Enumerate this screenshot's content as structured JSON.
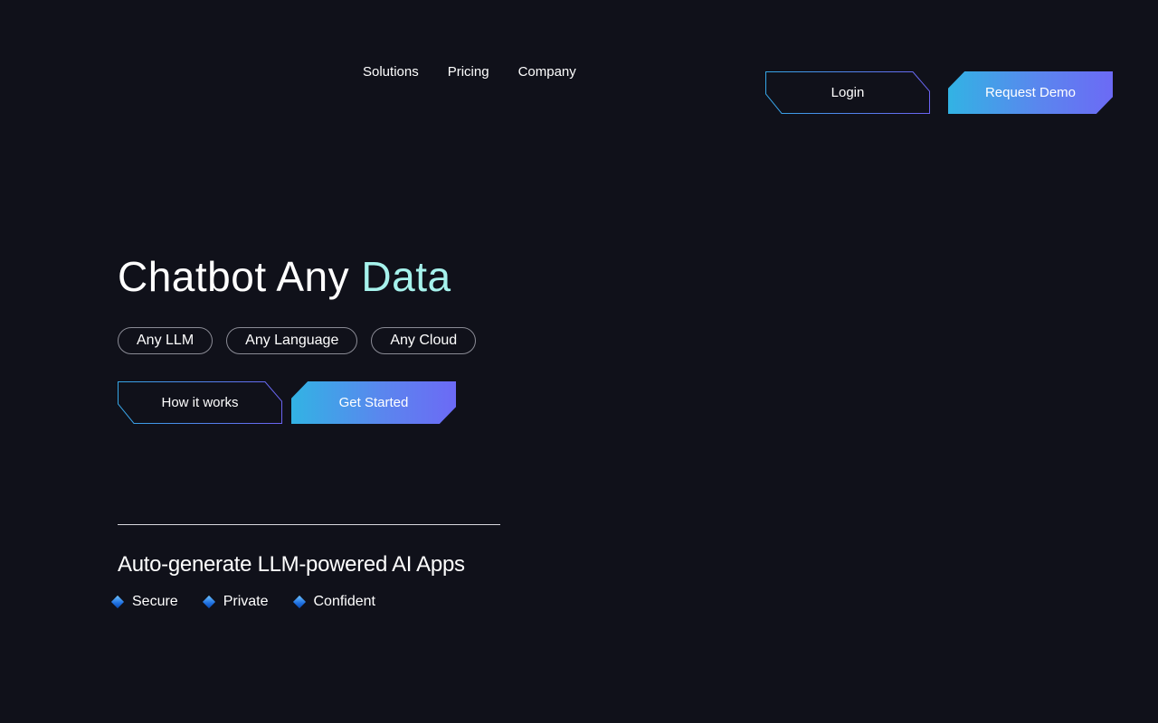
{
  "nav": {
    "links": [
      "Solutions",
      "Pricing",
      "Company"
    ],
    "login_label": "Login",
    "demo_label": "Request Demo"
  },
  "hero": {
    "title_word1": "Chatbot",
    "title_word2": "Any",
    "title_word3": "Data",
    "pills": [
      "Any LLM",
      "Any Language",
      "Any Cloud"
    ],
    "how_label": "How it works",
    "start_label": "Get Started"
  },
  "section": {
    "subtitle": "Auto-generate LLM-powered AI Apps",
    "features": [
      "Secure",
      "Private",
      "Confident"
    ]
  },
  "colors": {
    "background": "#10111a",
    "accent_text": "#a6f2ec",
    "gradient_start": "#32b3e4",
    "gradient_end": "#6c6af5"
  },
  "icons": {
    "feature_bullet": "diamond-icon"
  }
}
